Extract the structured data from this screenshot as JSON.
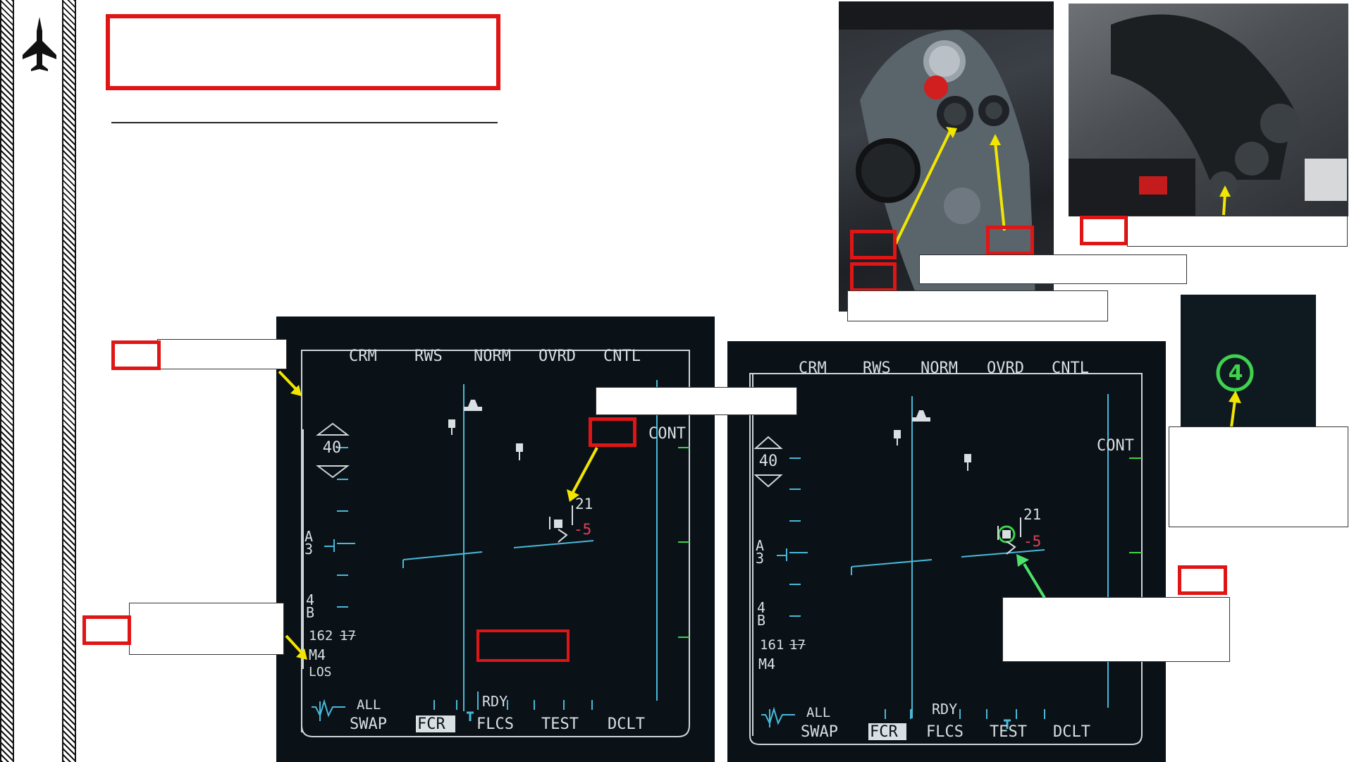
{
  "mfd_left": {
    "top_labels": [
      "CRM",
      "RWS",
      "NORM",
      "OVRD",
      "CNTL"
    ],
    "range_value": "40",
    "cont_label": "CONT",
    "azimuth_label": "A",
    "azimuth_value": "3",
    "bar_label": "4",
    "bar_value": "B",
    "track_num_a": "162",
    "track_num_b": "17",
    "mode_label": "M4",
    "los_label": "LOS",
    "target_alt": "21",
    "target_closure": "-5",
    "bottom_top_labels": [
      "ALL",
      "RDY"
    ],
    "bottom_labels": [
      "SWAP",
      "FCR",
      "FLCS",
      "TEST",
      "DCLT"
    ]
  },
  "mfd_right": {
    "top_labels": [
      "CRM",
      "RWS",
      "NORM",
      "OVRD",
      "CNTL"
    ],
    "range_value": "40",
    "cont_label": "CONT",
    "azimuth_label": "A",
    "azimuth_value": "3",
    "bar_label": "4",
    "bar_value": "B",
    "track_num_a": "161",
    "track_num_b": "17",
    "mode_label": "M4",
    "target_alt": "21",
    "target_closure": "-5",
    "bottom_top_labels": [
      "ALL",
      "RDY"
    ],
    "bottom_labels": [
      "SWAP",
      "FCR",
      "FLCS",
      "TEST",
      "DCLT"
    ]
  },
  "indicator": {
    "value": "4"
  },
  "colors": {
    "highlight_red": "#e01515",
    "arrow_yellow": "#f2e600",
    "arrow_green": "#4de26a",
    "mfd_cyan": "#49b8d8",
    "mfd_green": "#3fd24e",
    "mfd_magenta": "#e0405a"
  }
}
